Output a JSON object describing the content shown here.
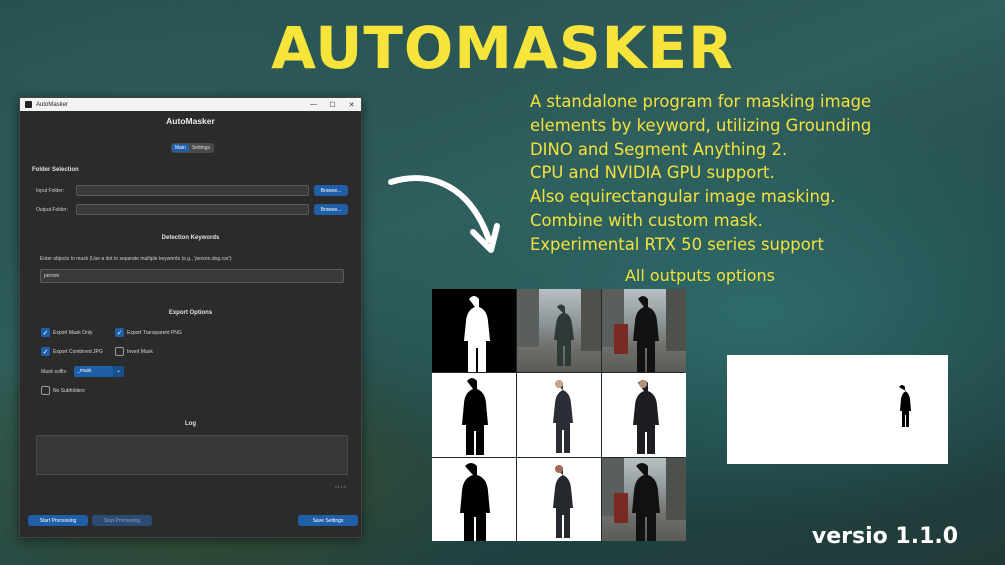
{
  "headline": "AUTOMASKER",
  "features": [
    "A standalone program for masking image",
    "elements by keyword, utilizing Grounding",
    "DINO and Segment Anything 2.",
    "CPU and NVIDIA GPU support.",
    "Also equirectangular image masking.",
    "Combine with custom mask.",
    "Experimental RTX 50 series support"
  ],
  "outputs_title": "All outputs options",
  "version_text": "versio 1.1.0",
  "colors": {
    "accent_yellow": "#f4e23a",
    "app_blue": "#1f5fa8",
    "app_bg": "#2b2b2b"
  },
  "window": {
    "titlebar_title": "AutoMasker",
    "controls": [
      "—",
      "☐",
      "✕"
    ],
    "app_title": "AutoMasker",
    "tabs": [
      {
        "label": "Main",
        "active": true
      },
      {
        "label": "Settings",
        "active": false
      }
    ],
    "folder_section": "Folder Selection",
    "input_folder_label": "Input Folder:",
    "input_folder_value": "",
    "output_folder_label": "Output Folder:",
    "output_folder_value": "",
    "browse_label": "Browse...",
    "detection_section": "Detection Keywords",
    "keywords_hint": "Enter objects to mask (Use a dot to separate multiple keywords (e.g., 'person.dog.car'):",
    "keywords_value": "person",
    "export_section": "Export Options",
    "checkboxes": [
      {
        "label": "Export Mask Only",
        "checked": true
      },
      {
        "label": "Export Transparent PNG",
        "checked": true
      },
      {
        "label": "Export Combined JPG",
        "checked": true
      },
      {
        "label": "Invert Mask",
        "checked": false
      }
    ],
    "mask_suffix_label": "Mask suffix:",
    "mask_suffix_value": "_mask",
    "no_subfolders_label": "No Subfolders",
    "no_subfolders_checked": false,
    "log_section": "Log",
    "small_version": "v1.1.0",
    "start_label": "Start Processing",
    "stop_label": "Stop Processing",
    "save_label": "Save Settings"
  }
}
